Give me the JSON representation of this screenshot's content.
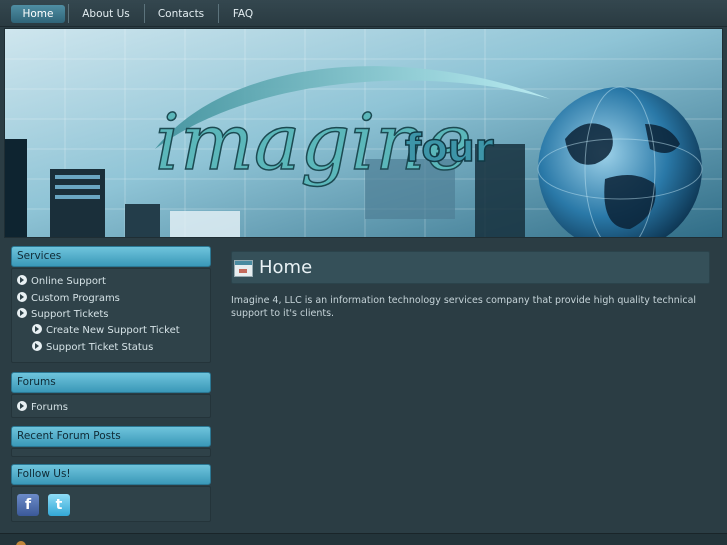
{
  "nav": {
    "items": [
      {
        "label": "Home",
        "active": true
      },
      {
        "label": "About Us",
        "active": false
      },
      {
        "label": "Contacts",
        "active": false
      },
      {
        "label": "FAQ",
        "active": false
      }
    ]
  },
  "banner": {
    "logo_main": "imagine",
    "logo_sub": "four"
  },
  "sidebar": {
    "services": {
      "title": "Services",
      "items": [
        "Online Support",
        "Custom Programs",
        "Support Tickets"
      ],
      "subitems": [
        "Create New Support Ticket",
        "Support Ticket Status"
      ]
    },
    "forums": {
      "title": "Forums",
      "items": [
        "Forums"
      ]
    },
    "recent_posts": {
      "title": "Recent Forum Posts"
    },
    "follow": {
      "title": "Follow Us!",
      "icons": [
        "facebook-icon",
        "twitter-icon"
      ]
    }
  },
  "main": {
    "title": "Home",
    "body": "Imagine 4, LLC is an information technology services company that provide high quality technical support to it's clients."
  },
  "colors": {
    "background": "#2b3d44",
    "accent": "#3a98b8",
    "nav_active": "#4f8ea3"
  }
}
